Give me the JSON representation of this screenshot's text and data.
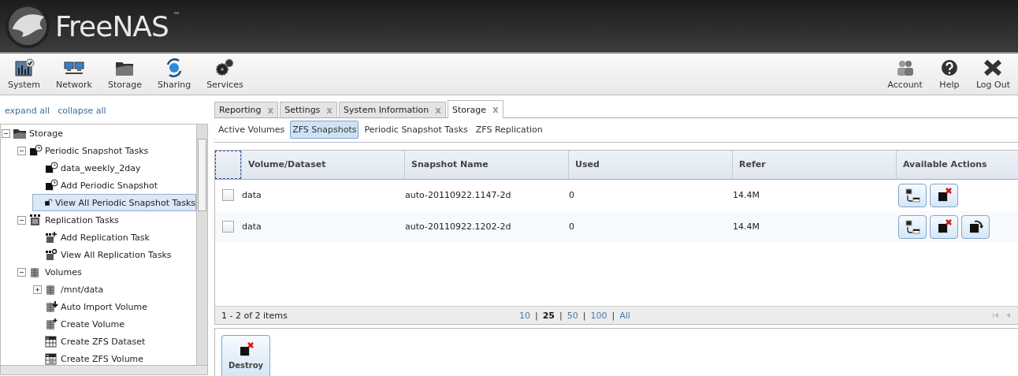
{
  "logo": {
    "text": "FreeNAS",
    "mark": "™"
  },
  "toolbar": {
    "left": [
      {
        "label": "System",
        "kind": "system"
      },
      {
        "label": "Network",
        "kind": "network"
      },
      {
        "label": "Storage",
        "kind": "storage"
      },
      {
        "label": "Sharing",
        "kind": "sharing"
      },
      {
        "label": "Services",
        "kind": "services"
      }
    ],
    "right": [
      {
        "label": "Account",
        "kind": "account"
      },
      {
        "label": "Help",
        "kind": "help"
      },
      {
        "label": "Log Out",
        "kind": "logout"
      }
    ]
  },
  "sidebar": {
    "links": [
      "expand all",
      "collapse all"
    ],
    "tree": [
      {
        "label": "Storage",
        "kind": "folder",
        "expanded": true,
        "selected": false,
        "children": [
          {
            "label": "Periodic Snapshot Tasks",
            "kind": "snapclock",
            "expanded": true,
            "selected": false,
            "children": [
              {
                "label": "data_weekly_2day",
                "kind": "snapclock",
                "selected": false
              },
              {
                "label": "Add Periodic Snapshot",
                "kind": "snapclock",
                "selected": false
              },
              {
                "label": "View All Periodic Snapshot Tasks",
                "kind": "snapview",
                "selected": true
              }
            ]
          },
          {
            "label": "Replication Tasks",
            "kind": "repl",
            "expanded": true,
            "selected": false,
            "children": [
              {
                "label": "Add Replication Task",
                "kind": "repladd",
                "selected": false
              },
              {
                "label": "View All Replication Tasks",
                "kind": "replview",
                "selected": false
              }
            ]
          },
          {
            "label": "Volumes",
            "kind": "volume",
            "expanded": true,
            "selected": false,
            "children": [
              {
                "label": "/mnt/data",
                "kind": "volume",
                "expanded": false,
                "selected": false
              },
              {
                "label": "Auto Import Volume",
                "kind": "volimport",
                "selected": false
              },
              {
                "label": "Create Volume",
                "kind": "voladd",
                "selected": false
              },
              {
                "label": "Create ZFS Dataset",
                "kind": "dataset",
                "selected": false
              },
              {
                "label": "Create ZFS Volume",
                "kind": "zvol",
                "selected": false
              }
            ]
          }
        ]
      }
    ]
  },
  "tabs": [
    {
      "label": "Reporting",
      "close": "x",
      "selected": false
    },
    {
      "label": "Settings",
      "close": "x",
      "selected": false
    },
    {
      "label": "System Information",
      "close": "x",
      "selected": false
    },
    {
      "label": "Storage",
      "close": "x",
      "selected": true
    }
  ],
  "subtabs": [
    {
      "label": "Active Volumes",
      "selected": false
    },
    {
      "label": "ZFS Snapshots",
      "selected": true
    },
    {
      "label": "Periodic Snapshot Tasks",
      "selected": false
    },
    {
      "label": "ZFS Replication",
      "selected": false
    }
  ],
  "table": {
    "columns": [
      "Volume/Dataset",
      "Snapshot Name",
      "Used",
      "Refer",
      "Available Actions"
    ],
    "rows": [
      {
        "checked": false,
        "cells": [
          "data",
          "auto-20110922.1147-2d",
          "0",
          "14.4M"
        ],
        "actions": [
          {
            "kind": "clone"
          },
          {
            "kind": "destroy"
          }
        ]
      },
      {
        "checked": false,
        "cells": [
          "data",
          "auto-20110922.1202-2d",
          "0",
          "14.4M"
        ],
        "actions": [
          {
            "kind": "clone"
          },
          {
            "kind": "destroy"
          },
          {
            "kind": "rollback"
          }
        ]
      }
    ]
  },
  "pager": {
    "summary": "1 - 2 of 2 items",
    "sizes": [
      {
        "label": "10",
        "selected": false
      },
      {
        "label": "25",
        "selected": true
      },
      {
        "label": "50",
        "selected": false
      },
      {
        "label": "100",
        "selected": false
      },
      {
        "label": "All",
        "selected": false
      }
    ],
    "separator": "|"
  },
  "bulk_actions": [
    {
      "label": "Destroy",
      "kind": "destroy"
    }
  ]
}
